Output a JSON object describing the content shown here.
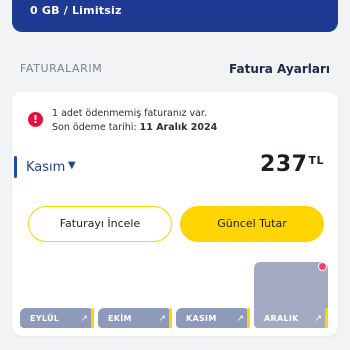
{
  "top_card": {
    "usage": "0 GB / Limitsiz",
    "background": "#1f3a93"
  },
  "section": {
    "title": "FATURALARIM",
    "link": "Fatura Ayarları"
  },
  "alert": {
    "line1": "1 adet ödenmemiş faturanız var.",
    "line2_prefix": "Son ödeme tarihi: ",
    "line2_date": "11 Aralık 2024",
    "icon": "alert-icon",
    "icon_glyph": "!",
    "color": "#e4113c"
  },
  "invoice": {
    "month": "Kasım",
    "amount": "237",
    "currency": "TL"
  },
  "buttons": {
    "view_invoice": "Faturayı İncele",
    "current_amount": "Güncel Tutar"
  },
  "chart_data": {
    "type": "bar",
    "categories": [
      "EYLÜL",
      "EKİM",
      "KASIM",
      "ARALIK"
    ],
    "values": [
      0.3,
      0.3,
      0.3,
      1.0
    ],
    "active_index": 3,
    "accent_color": "#ffd400",
    "bar_color": "#8e9ab9"
  }
}
